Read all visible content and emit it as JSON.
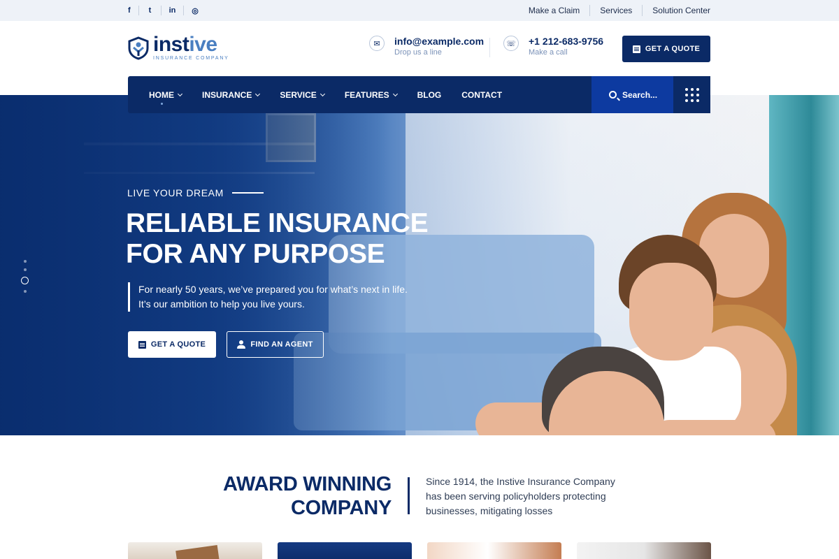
{
  "topbar": {
    "social": [
      {
        "icon": "facebook-icon",
        "glyph": "f"
      },
      {
        "icon": "twitter-icon",
        "glyph": "t"
      },
      {
        "icon": "linkedin-icon",
        "glyph": "in"
      },
      {
        "icon": "instagram-icon",
        "glyph": "◎"
      }
    ],
    "links": [
      "Make a Claim",
      "Services",
      "Solution Center"
    ]
  },
  "header": {
    "logo": {
      "name_part1": "inst",
      "name_part2": "ive",
      "tagline": "INSURANCE COMPANY"
    },
    "email": {
      "icon": "envelope-icon",
      "value": "info@example.com",
      "label": "Drop us a line"
    },
    "phone": {
      "icon": "phone-icon",
      "value": "+1 212-683-9756",
      "label": "Make a call"
    },
    "quote_button": "GET A QUOTE"
  },
  "nav": {
    "items": [
      {
        "label": "HOME",
        "dropdown": true
      },
      {
        "label": "INSURANCE",
        "dropdown": true
      },
      {
        "label": "SERVICE",
        "dropdown": true
      },
      {
        "label": "FEATURES",
        "dropdown": true
      },
      {
        "label": "BLOG",
        "dropdown": false
      },
      {
        "label": "CONTACT",
        "dropdown": false
      }
    ],
    "search_placeholder": "Search..."
  },
  "hero": {
    "eyebrow": "LIVE YOUR DREAM",
    "title_line1": "RELIABLE INSURANCE",
    "title_line2": "FOR ANY PURPOSE",
    "desc_line1": "For nearly 50 years, we’ve prepared you for what’s next in life.",
    "desc_line2": "It’s our ambition to help you live yours.",
    "quote_button": "GET A QUOTE",
    "agent_button": "FIND AN AGENT",
    "slider": {
      "count": 4,
      "active": 3
    }
  },
  "about": {
    "title_line1": "AWARD WINNING",
    "title_line2": "COMPANY",
    "desc_line1": "Since 1914, the Instive Insurance Company",
    "desc_line2": "has been serving policyholders  protecting",
    "desc_line3": "businesses, mitigating losses"
  },
  "colors": {
    "brand": "#0b2a66",
    "accent": "#4a7fc1",
    "search_bg": "#0d3aa0"
  }
}
